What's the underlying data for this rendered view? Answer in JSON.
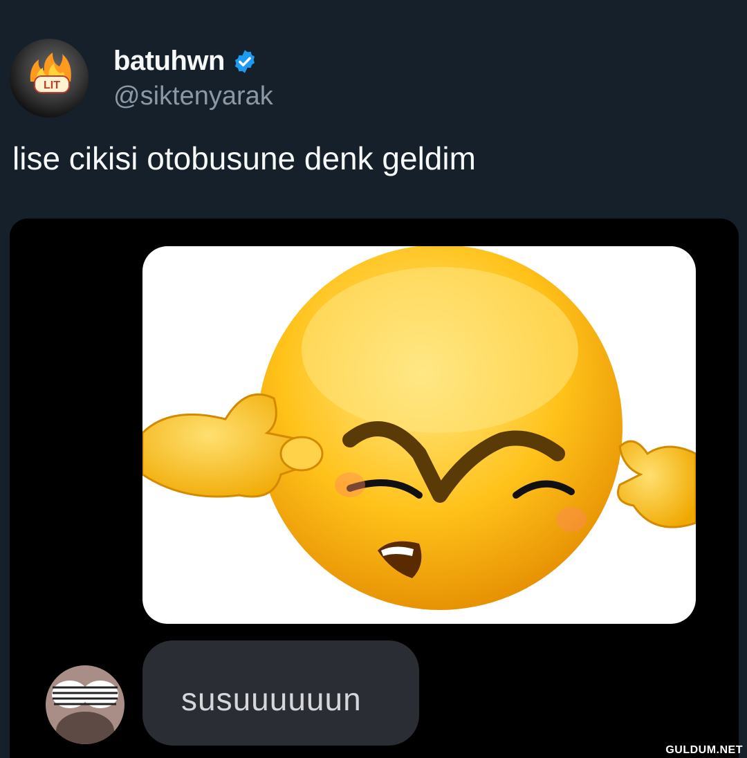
{
  "tweet": {
    "display_name": "batuhwn",
    "handle": "@siktenyarak",
    "verified": true,
    "text": "lise cikisi otobusune denk geldim",
    "avatar_badge": "LIT"
  },
  "media": {
    "emoji": "ears-plugged-frowning-emoji",
    "reply_bubble_text": "susuuuuuun",
    "reply_avatar": "shutter-shades-avatar"
  },
  "watermark": "GULDUM.NET",
  "colors": {
    "background": "#15202b",
    "verified_blue": "#1d9bf0",
    "handle_gray": "#8b98a5",
    "bubble": "#2a2d33"
  }
}
